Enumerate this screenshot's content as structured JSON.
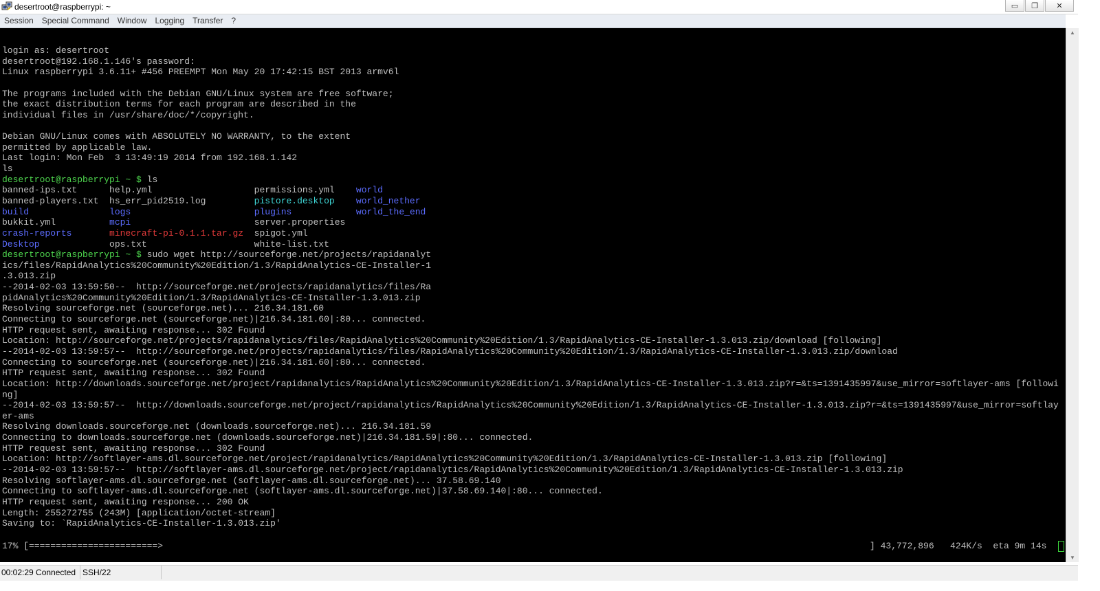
{
  "window": {
    "title": "desertroot@raspberrypi: ~",
    "buttons": {
      "minimize": "▭",
      "restore": "❐",
      "close": "✕"
    }
  },
  "menu": [
    "Session",
    "Special Command",
    "Window",
    "Logging",
    "Transfer",
    "?"
  ],
  "terminal": {
    "colors": {
      "prompt": "#4fd84f",
      "directory": "#5c6cff",
      "executable": "#3fd6d6",
      "archive": "#e23a3a",
      "text": "#c0c0c0"
    },
    "lines": [
      [
        {
          "t": "login as: desertroot",
          "c": "w"
        }
      ],
      [
        {
          "t": "desertroot@192.168.1.146's password:",
          "c": "w"
        }
      ],
      [
        {
          "t": "Linux raspberrypi 3.6.11+ #456 PREEMPT Mon May 20 17:42:15 BST 2013 armv6l",
          "c": "w"
        }
      ],
      [
        {
          "t": "",
          "c": "w"
        }
      ],
      [
        {
          "t": "The programs included with the Debian GNU/Linux system are free software;",
          "c": "w"
        }
      ],
      [
        {
          "t": "the exact distribution terms for each program are described in the",
          "c": "w"
        }
      ],
      [
        {
          "t": "individual files in /usr/share/doc/*/copyright.",
          "c": "w"
        }
      ],
      [
        {
          "t": "",
          "c": "w"
        }
      ],
      [
        {
          "t": "Debian GNU/Linux comes with ABSOLUTELY NO WARRANTY, to the extent",
          "c": "w"
        }
      ],
      [
        {
          "t": "permitted by applicable law.",
          "c": "w"
        }
      ],
      [
        {
          "t": "Last login: Mon Feb  3 13:49:19 2014 from 192.168.1.142",
          "c": "w"
        }
      ],
      [
        {
          "t": "ls",
          "c": "w"
        }
      ],
      [
        {
          "t": "desertroot@raspberrypi ~ $",
          "c": "g"
        },
        {
          "t": " ls",
          "c": "w"
        }
      ],
      [
        {
          "t": "banned-ips.txt      ",
          "c": "w"
        },
        {
          "t": "help.yml                   ",
          "c": "w"
        },
        {
          "t": "permissions.yml   ",
          "c": "w"
        },
        {
          "t": " world",
          "c": "b"
        }
      ],
      [
        {
          "t": "banned-players.txt  ",
          "c": "w"
        },
        {
          "t": "hs_err_pid2519.log         ",
          "c": "w"
        },
        {
          "t": "pistore.desktop",
          "c": "c"
        },
        {
          "t": "    world_nether",
          "c": "b"
        }
      ],
      [
        {
          "t": "build",
          "c": "b"
        },
        {
          "t": "               ",
          "c": "w"
        },
        {
          "t": "logs",
          "c": "b"
        },
        {
          "t": "                       ",
          "c": "w"
        },
        {
          "t": "plugins",
          "c": "b"
        },
        {
          "t": "            world_the_end",
          "c": "b"
        }
      ],
      [
        {
          "t": "bukkit.yml          ",
          "c": "w"
        },
        {
          "t": "mcpi",
          "c": "b"
        },
        {
          "t": "                       ",
          "c": "w"
        },
        {
          "t": "server.properties",
          "c": "w"
        }
      ],
      [
        {
          "t": "crash-reports",
          "c": "b"
        },
        {
          "t": "       ",
          "c": "w"
        },
        {
          "t": "minecraft-pi-0.1.1.tar.gz",
          "c": "r"
        },
        {
          "t": "  spigot.yml",
          "c": "w"
        }
      ],
      [
        {
          "t": "Desktop",
          "c": "b"
        },
        {
          "t": "             ops.txt                    white-list.txt",
          "c": "w"
        }
      ],
      [
        {
          "t": "desertroot@raspberrypi ~ $",
          "c": "g"
        },
        {
          "t": " sudo wget http://sourceforge.net/projects/rapidanalyt",
          "c": "w"
        }
      ],
      [
        {
          "t": "ics/files/RapidAnalytics%20Community%20Edition/1.3/RapidAnalytics-CE-Installer-1",
          "c": "w"
        }
      ],
      [
        {
          "t": ".3.013.zip",
          "c": "w"
        }
      ],
      [
        {
          "t": "--2014-02-03 13:59:50--  http://sourceforge.net/projects/rapidanalytics/files/Ra",
          "c": "w"
        }
      ],
      [
        {
          "t": "pidAnalytics%20Community%20Edition/1.3/RapidAnalytics-CE-Installer-1.3.013.zip",
          "c": "w"
        }
      ],
      [
        {
          "t": "Resolving sourceforge.net (sourceforge.net)... 216.34.181.60",
          "c": "w"
        }
      ],
      [
        {
          "t": "Connecting to sourceforge.net (sourceforge.net)|216.34.181.60|:80... connected.",
          "c": "w"
        }
      ],
      [
        {
          "t": "HTTP request sent, awaiting response... 302 Found",
          "c": "w"
        }
      ],
      [
        {
          "t": "Location: http://sourceforge.net/projects/rapidanalytics/files/RapidAnalytics%20Community%20Edition/1.3/RapidAnalytics-CE-Installer-1.3.013.zip/download [following]",
          "c": "w"
        }
      ],
      [
        {
          "t": "--2014-02-03 13:59:57--  http://sourceforge.net/projects/rapidanalytics/files/RapidAnalytics%20Community%20Edition/1.3/RapidAnalytics-CE-Installer-1.3.013.zip/download",
          "c": "w"
        }
      ],
      [
        {
          "t": "Connecting to sourceforge.net (sourceforge.net)|216.34.181.60|:80... connected.",
          "c": "w"
        }
      ],
      [
        {
          "t": "HTTP request sent, awaiting response... 302 Found",
          "c": "w"
        }
      ],
      [
        {
          "t": "Location: http://downloads.sourceforge.net/project/rapidanalytics/RapidAnalytics%20Community%20Edition/1.3/RapidAnalytics-CE-Installer-1.3.013.zip?r=&ts=1391435997&use_mirror=softlayer-ams [followi",
          "c": "w"
        }
      ],
      [
        {
          "t": "ng]",
          "c": "w"
        }
      ],
      [
        {
          "t": "--2014-02-03 13:59:57--  http://downloads.sourceforge.net/project/rapidanalytics/RapidAnalytics%20Community%20Edition/1.3/RapidAnalytics-CE-Installer-1.3.013.zip?r=&ts=1391435997&use_mirror=softlay",
          "c": "w"
        }
      ],
      [
        {
          "t": "er-ams",
          "c": "w"
        }
      ],
      [
        {
          "t": "Resolving downloads.sourceforge.net (downloads.sourceforge.net)... 216.34.181.59",
          "c": "w"
        }
      ],
      [
        {
          "t": "Connecting to downloads.sourceforge.net (downloads.sourceforge.net)|216.34.181.59|:80... connected.",
          "c": "w"
        }
      ],
      [
        {
          "t": "HTTP request sent, awaiting response... 302 Found",
          "c": "w"
        }
      ],
      [
        {
          "t": "Location: http://softlayer-ams.dl.sourceforge.net/project/rapidanalytics/RapidAnalytics%20Community%20Edition/1.3/RapidAnalytics-CE-Installer-1.3.013.zip [following]",
          "c": "w"
        }
      ],
      [
        {
          "t": "--2014-02-03 13:59:57--  http://softlayer-ams.dl.sourceforge.net/project/rapidanalytics/RapidAnalytics%20Community%20Edition/1.3/RapidAnalytics-CE-Installer-1.3.013.zip",
          "c": "w"
        }
      ],
      [
        {
          "t": "Resolving softlayer-ams.dl.sourceforge.net (softlayer-ams.dl.sourceforge.net)... 37.58.69.140",
          "c": "w"
        }
      ],
      [
        {
          "t": "Connecting to softlayer-ams.dl.sourceforge.net (softlayer-ams.dl.sourceforge.net)|37.58.69.140|:80... connected.",
          "c": "w"
        }
      ],
      [
        {
          "t": "HTTP request sent, awaiting response... 200 OK",
          "c": "w"
        }
      ],
      [
        {
          "t": "Length: 255272755 (243M) [application/octet-stream]",
          "c": "w"
        }
      ],
      [
        {
          "t": "Saving to: `RapidAnalytics-CE-Installer-1.3.013.zip'",
          "c": "w"
        }
      ]
    ],
    "progress": {
      "left": "17% [========================>",
      "right": "] 43,772,896   424K/s  eta 9m 14s",
      "percent": 17
    }
  },
  "status": {
    "connection": "00:02:29 Connected",
    "protocol": "SSH/22"
  }
}
